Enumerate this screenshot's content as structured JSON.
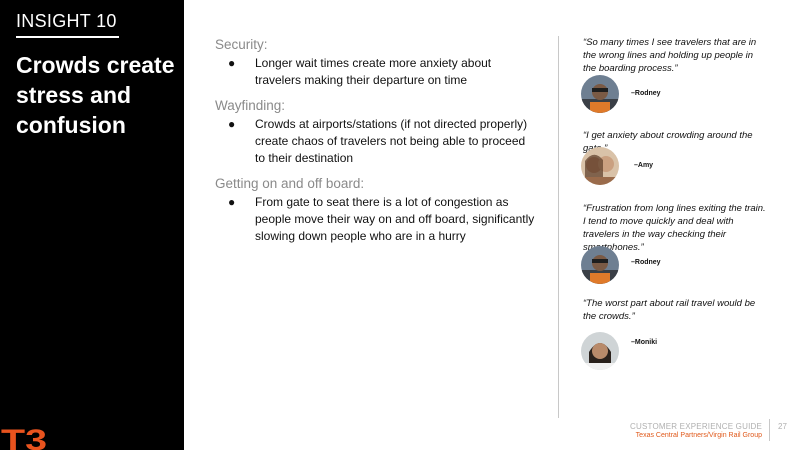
{
  "left": {
    "insight_label": "INSIGHT 10",
    "title": "Crowds create stress and confusion",
    "logo_text": "T3",
    "logo_color": "#e8531e"
  },
  "sections": [
    {
      "heading": "Security:",
      "bullet": "Longer wait times create more anxiety about travelers making their departure on time"
    },
    {
      "heading": "Wayfinding:",
      "bullet": "Crowds at airports/stations (if not directed properly) create chaos of travelers not being able to proceed to their destination"
    },
    {
      "heading": "Getting on and off board:",
      "bullet": "From gate to seat there is a lot of congestion as people move their way on and off board, significantly slowing down people who are in a hurry"
    }
  ],
  "bullet_symbol": "●",
  "quotes": [
    {
      "text": "“So many times I see travelers that are in the wrong lines and holding up people in the boarding process.”",
      "author": "–Rodney"
    },
    {
      "text": "“I get anxiety about crowding around the gate.”",
      "author": "–Amy"
    },
    {
      "text": "“Frustration from long lines exiting the train. I tend to move quickly and deal with travelers in the way checking their smartphones.”",
      "author": "–Rodney"
    },
    {
      "text": "“The worst part about rail travel would be the crowds.”",
      "author": "–Moniki"
    }
  ],
  "footer": {
    "title": "CUSTOMER EXPERIENCE GUIDE",
    "subtitle": "Texas Central Partners/Virgin Rail Group",
    "page_number": "27"
  },
  "colors": {
    "accent": "#e05a1c",
    "panel": "#000000",
    "heading_gray": "#8a8a8a"
  }
}
